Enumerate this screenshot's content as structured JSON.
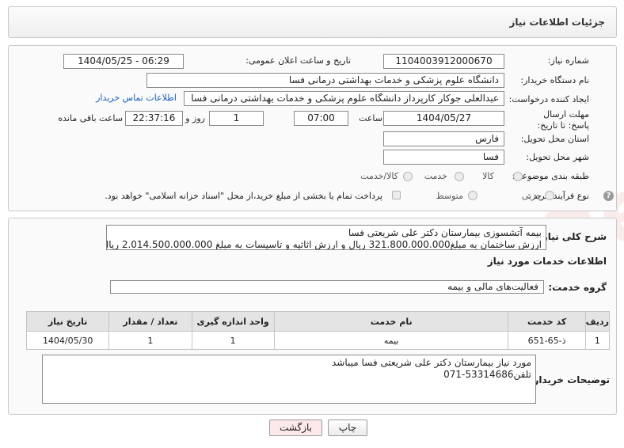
{
  "header": {
    "title": "جزئیات اطلاعات نیاز"
  },
  "form": {
    "need_number_label": "شماره نیاز:",
    "need_number": "1104003912000670",
    "announce_label": "تاریخ و ساعت اعلان عمومی:",
    "announce_value": "1404/05/25 - 06:29",
    "buyer_org_label": "نام دستگاه خریدار:",
    "buyer_org": "دانشگاه علوم پزشکی و خدمات بهداشتی درمانی فسا",
    "requester_label": "ایجاد کننده درخواست:",
    "requester": "عبدالعلی جوکار کارپرداز دانشگاه علوم پزشکی و خدمات بهداشتی درمانی فسا",
    "contact_link": "اطلاعات تماس خریدار",
    "deadline_label": "مهلت ارسال پاسخ: تا تاریخ:",
    "deadline_date": "1404/05/27",
    "time_label": "ساعت",
    "deadline_time": "07:00",
    "days_value": "1",
    "days_label": "روز و",
    "remaining_time": "22:37:16",
    "remaining_label": "ساعت باقی مانده",
    "province_label": "استان محل تحویل:",
    "province": "فارس",
    "city_label": "شهر محل تحویل:",
    "city": "فسا",
    "category_label": "طبقه بندی موضوعی:",
    "category_options": [
      "کالا",
      "خدمت",
      "کالا/خدمت"
    ],
    "process_label": "نوع فرآیند خرید :",
    "process_options": [
      "جزیی",
      "متوسط"
    ],
    "payment_note": "پرداخت تمام یا بخشی از مبلغ خرید،از محل \"اسناد خزانه اسلامی\" خواهد بود."
  },
  "summary": {
    "label": "شرح کلی نیاز:",
    "line1": "بیمه آتشسوزی بیمارستان دکتر علی شریعتی فسا",
    "line2": "ارزش ساختمان به مبلغ321.800.000.000 ریال و ارزش اثاثیه و تاسیسات به مبلغ 2.014.500.000.000 ریال"
  },
  "services": {
    "section_title": "اطلاعات خدمات مورد نیاز",
    "group_label": "گروه خدمت:",
    "group_value": "فعالیت‌های مالی و بیمه",
    "columns": [
      "ردیف",
      "کد خدمت",
      "نام خدمت",
      "واحد اندازه گیری",
      "تعداد / مقدار",
      "تاریخ نیاز"
    ],
    "rows": [
      [
        "1",
        "ذ-65-651",
        "بیمه",
        "1",
        "1",
        "1404/05/30"
      ]
    ]
  },
  "buyer_notes": {
    "label": "توضیحات خریدار:",
    "line1": "مورد نیاز بیمارستان دکتر علی شریعتی فسا میباشد",
    "line2": "تلفن53314686-071"
  },
  "buttons": {
    "print": "چاپ",
    "back": "بازگشت"
  },
  "watermark": "AriaTender.neT",
  "colors": {
    "link": "#1a5fb4",
    "back_button_bg": "#fde8ea",
    "header_bg": "#e4e4e4"
  }
}
